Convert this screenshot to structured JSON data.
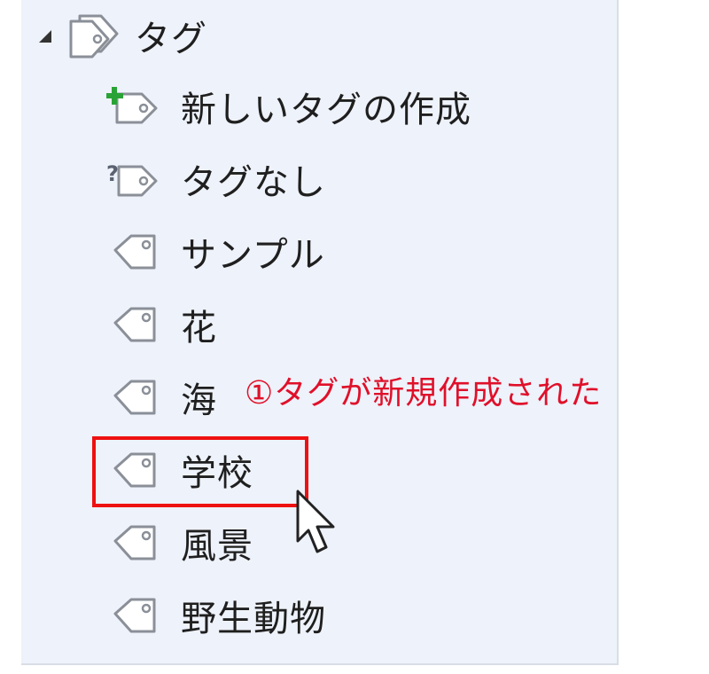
{
  "tree": {
    "root": {
      "label": "タグ",
      "icon": "tags-icon",
      "expanded": true
    },
    "items": [
      {
        "label": "新しいタグの作成",
        "icon": "new-tag-icon"
      },
      {
        "label": "タグなし",
        "icon": "untagged-icon"
      },
      {
        "label": "サンプル",
        "icon": "tag-icon"
      },
      {
        "label": "花",
        "icon": "tag-icon"
      },
      {
        "label": "海",
        "icon": "tag-icon"
      },
      {
        "label": "学校",
        "icon": "tag-icon"
      },
      {
        "label": "風景",
        "icon": "tag-icon"
      },
      {
        "label": "野生動物",
        "icon": "tag-icon"
      }
    ]
  },
  "annotation": {
    "text": "①タグが新規作成された"
  },
  "colors": {
    "panel_background": "#eef2fa",
    "annotation_text": "#e0102a",
    "highlight_border": "#ee1111",
    "new_tag_plus": "#2aa336"
  }
}
